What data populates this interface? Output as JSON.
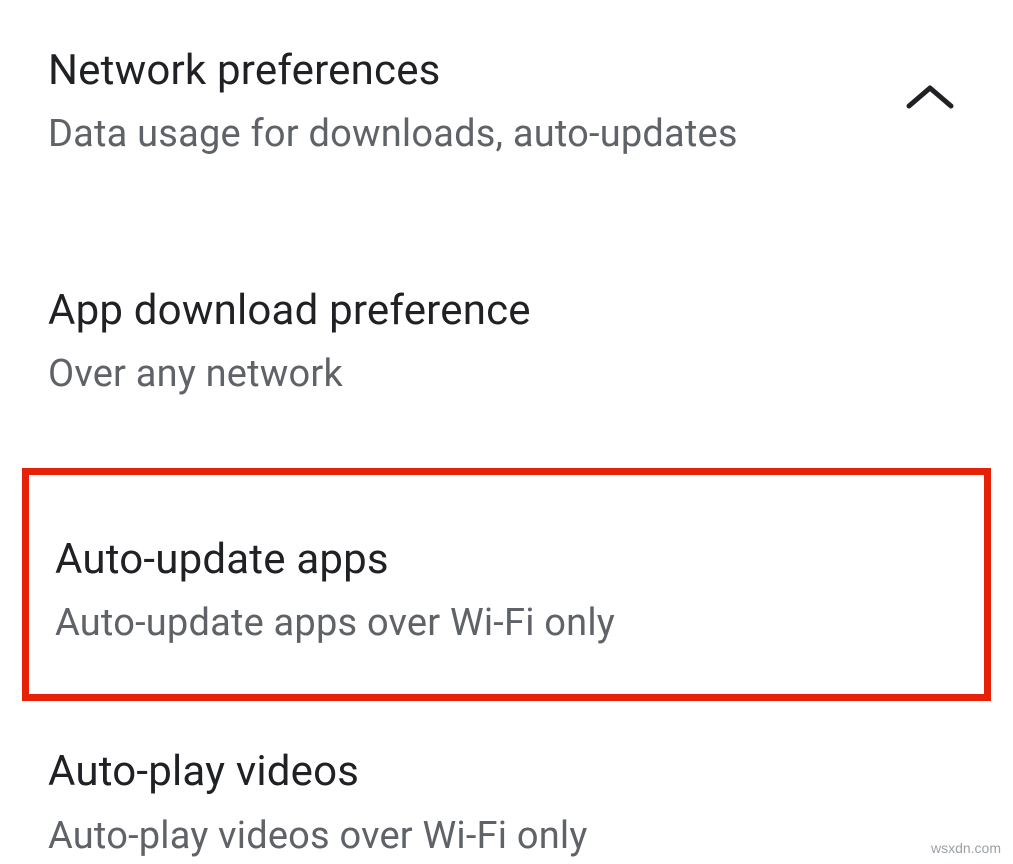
{
  "header": {
    "title": "Network preferences",
    "subtitle": "Data usage for downloads, auto-updates"
  },
  "settings": [
    {
      "title": "App download preference",
      "subtitle": "Over any network"
    },
    {
      "title": "Auto-update apps",
      "subtitle": "Auto-update apps over Wi-Fi only"
    },
    {
      "title": "Auto-play videos",
      "subtitle": "Auto-play videos over Wi-Fi only"
    }
  ],
  "watermark": "wsxdn.com"
}
